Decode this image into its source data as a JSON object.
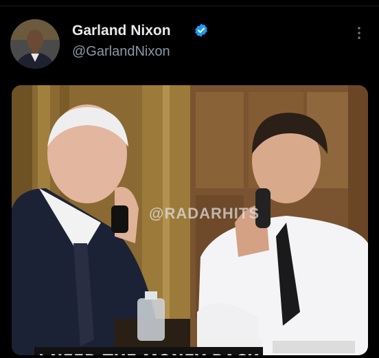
{
  "post": {
    "author_name": "Garland Nixon",
    "author_handle": "@GarlandNixon",
    "verified": true
  },
  "media": {
    "watermark": "@RADARHITS",
    "caption": "I NEED THE MONEY BACK"
  },
  "icons": {
    "verified": "verified-badge-icon",
    "more": "more-options-icon"
  },
  "colors": {
    "background": "#000000",
    "name_text": "#e7e9ea",
    "handle_text": "#8b98a5",
    "verified_badge": "#1d9bf0"
  }
}
